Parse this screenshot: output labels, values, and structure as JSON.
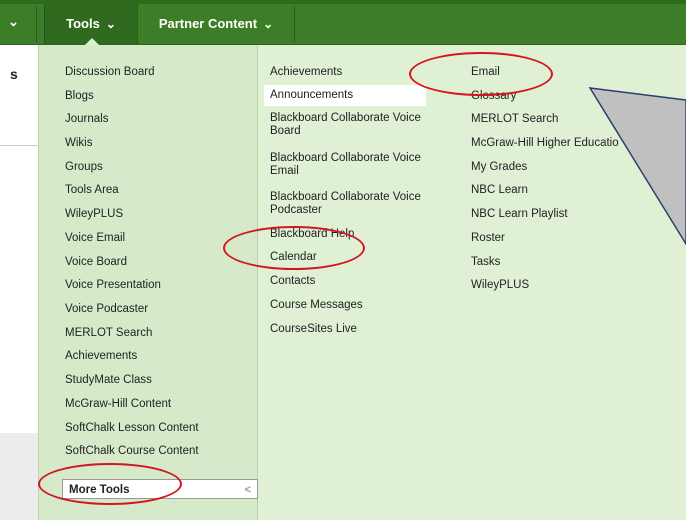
{
  "nav": {
    "tabs": [
      {
        "label": "Tools",
        "chevron": "⌄"
      },
      {
        "label": "Partner Content",
        "chevron": "⌄"
      }
    ],
    "left_chevron": "⌄"
  },
  "page": {
    "left_letter": "s"
  },
  "menu": {
    "col1": [
      "Discussion Board",
      "Blogs",
      "Journals",
      "Wikis",
      "Groups",
      "Tools Area",
      "WileyPLUS",
      "Voice Email",
      "Voice Board",
      "Voice Presentation",
      "Voice Podcaster",
      "MERLOT Search",
      "Achievements",
      "StudyMate Class",
      "McGraw-Hill Content",
      "SoftChalk Lesson Content",
      "SoftChalk Course Content"
    ],
    "more_tools": "More Tools",
    "more_tools_arrow": "<",
    "col2": [
      "Achievements",
      "Announcements",
      "Blackboard Collaborate Voice Board",
      "Blackboard Collaborate Voice Email",
      "Blackboard Collaborate Voice Podcaster",
      "Blackboard Help",
      "Calendar",
      "Contacts",
      "Course Messages",
      "CourseSites Live"
    ],
    "col3": [
      "Email",
      "Glossary",
      "MERLOT Search",
      "McGraw-Hill Higher Educatio",
      "My Grades",
      "NBC Learn",
      "NBC Learn Playlist",
      "Roster",
      "Tasks",
      "WileyPLUS"
    ]
  },
  "colors": {
    "nav_green": "#3d7d28",
    "menu_bg": "#dff0d5",
    "annotation_red": "#d4151f",
    "callout_gray": "#c0c0c0"
  }
}
